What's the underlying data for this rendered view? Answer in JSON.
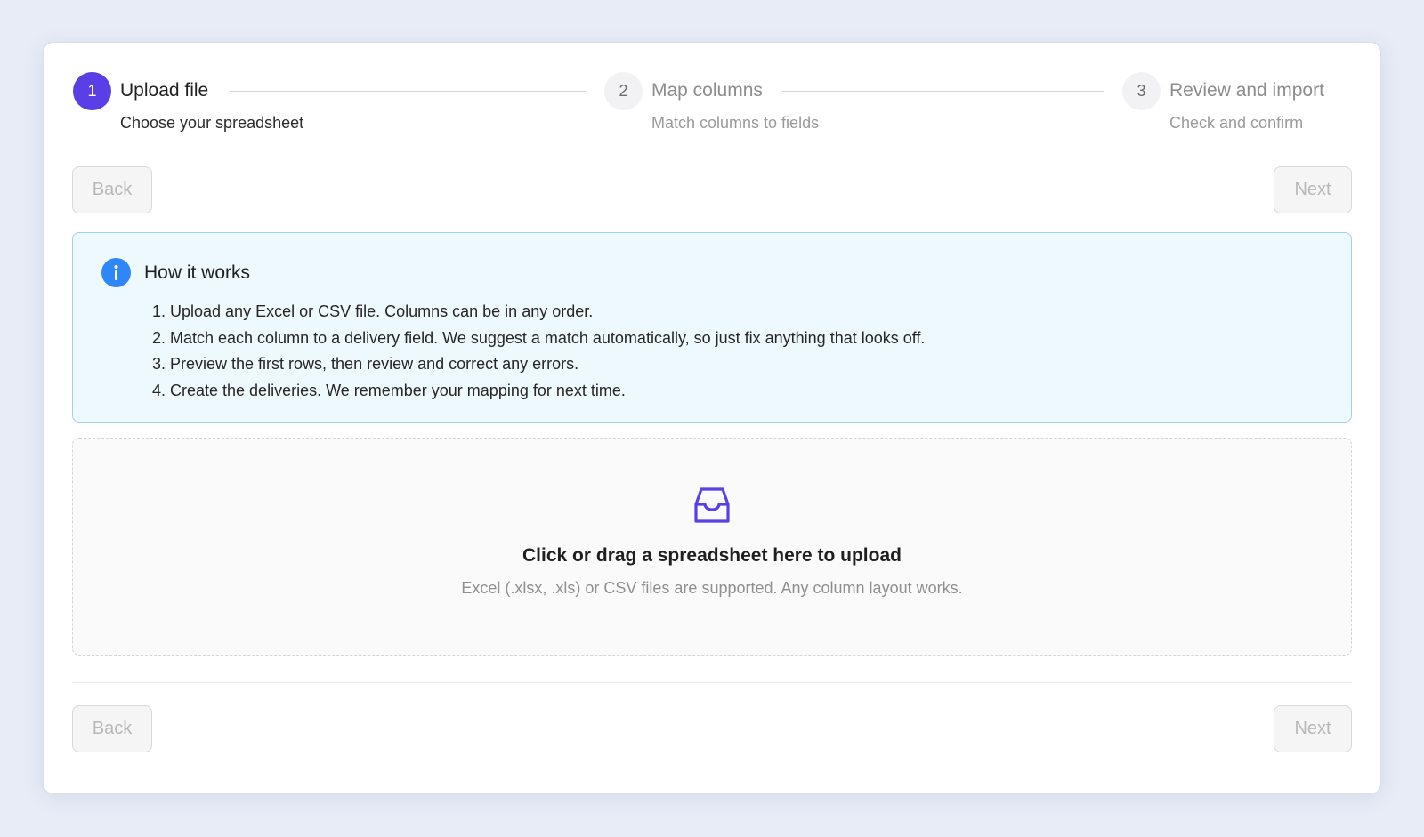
{
  "steps": [
    {
      "number": "1",
      "title": "Upload file",
      "subtitle": "Choose your spreadsheet",
      "state": "active"
    },
    {
      "number": "2",
      "title": "Map columns",
      "subtitle": "Match columns to fields",
      "state": "inactive"
    },
    {
      "number": "3",
      "title": "Review and import",
      "subtitle": "Check and confirm",
      "state": "inactive"
    }
  ],
  "nav_top": {
    "back_label": "Back",
    "next_label": "Next"
  },
  "info": {
    "title": "How it works",
    "items": [
      {
        "num": "1.",
        "text": "Upload any Excel or CSV file. Columns can be in any order."
      },
      {
        "num": "2.",
        "text": "Match each column to a delivery field. We suggest a match automatically, so just fix anything that looks off."
      },
      {
        "num": "3.",
        "text": "Preview the first rows, then review and correct any errors."
      },
      {
        "num": "4.",
        "text": "Create the deliveries. We remember your mapping for next time."
      }
    ]
  },
  "dropzone": {
    "icon": "inbox-icon",
    "title": "Click or drag a spreadsheet here to upload",
    "hint": "Excel (.xlsx, .xls) or CSV files are supported. Any column layout works."
  },
  "nav_bottom": {
    "back_label": "Back",
    "next_label": "Next"
  },
  "colors": {
    "accent": "#5b3fe6",
    "info_icon": "#2f86f6",
    "info_background": "#eef9fd",
    "info_border": "#9bd4e9",
    "page_background": "#e8ecf7"
  }
}
